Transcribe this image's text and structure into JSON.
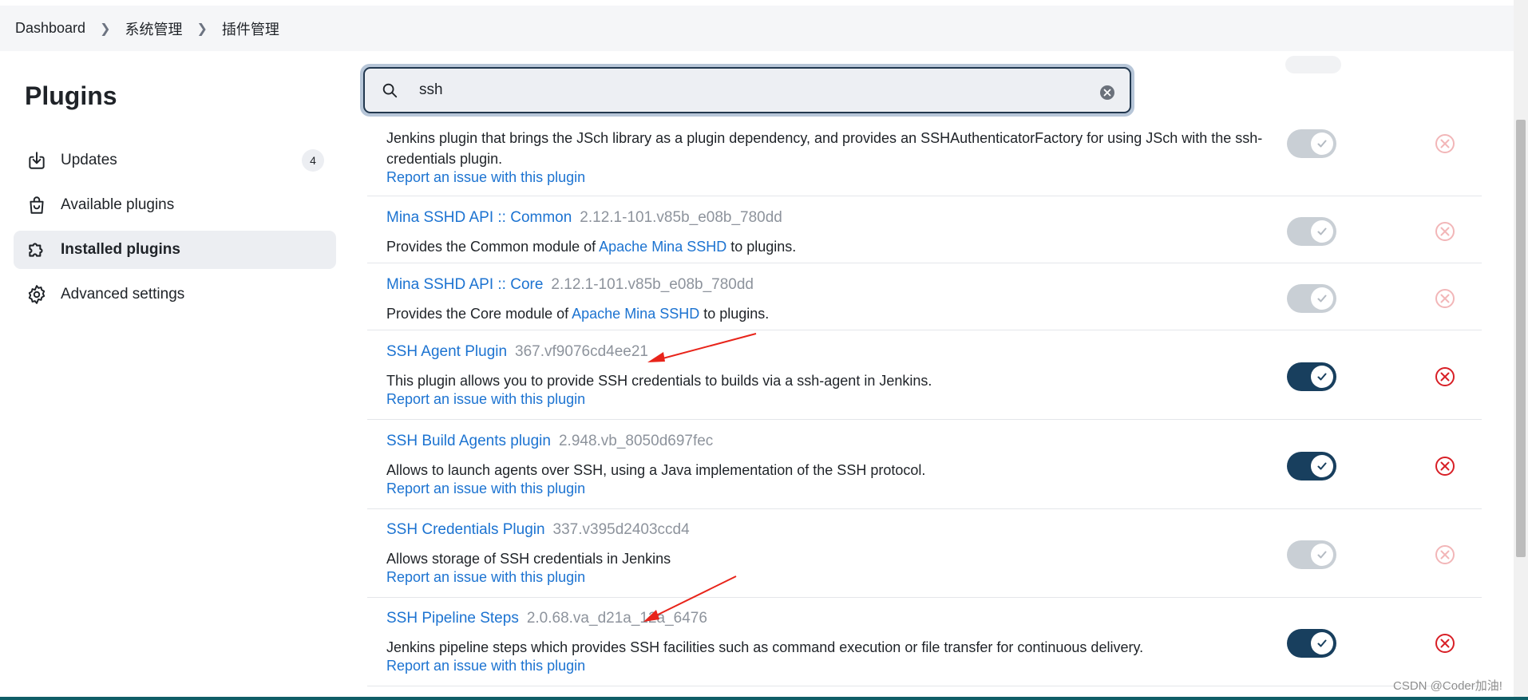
{
  "breadcrumb": [
    "Dashboard",
    "系统管理",
    "插件管理"
  ],
  "sidebar": {
    "title": "Plugins",
    "items": [
      {
        "label": "Updates",
        "badge": "4"
      },
      {
        "label": "Available plugins"
      },
      {
        "label": "Installed plugins"
      },
      {
        "label": "Advanced settings"
      }
    ]
  },
  "search": {
    "value": "ssh"
  },
  "plugins": [
    {
      "name": "",
      "version": "",
      "desc_parts": [
        "Jenkins plugin that brings the JSch library as a plugin dependency, and provides an SSHAuthenticatorFactory for using JSch with the ssh-credentials plugin."
      ],
      "report": "Report an issue with this plugin",
      "enabled": false
    },
    {
      "name": "Mina SSHD API :: Common",
      "version": "2.12.1-101.v85b_e08b_780dd",
      "desc_parts": [
        "Provides the Common module of ",
        "Apache Mina SSHD",
        " to plugins."
      ],
      "report": "",
      "enabled": false
    },
    {
      "name": "Mina SSHD API :: Core",
      "version": "2.12.1-101.v85b_e08b_780dd",
      "desc_parts": [
        "Provides the Core module of ",
        "Apache Mina SSHD",
        " to plugins."
      ],
      "report": "",
      "enabled": false
    },
    {
      "name": "SSH Agent Plugin",
      "version": "367.vf9076cd4ee21",
      "desc_parts": [
        "This plugin allows you to provide SSH credentials to builds via a ssh-agent in Jenkins."
      ],
      "report": "Report an issue with this plugin",
      "enabled": true
    },
    {
      "name": "SSH Build Agents plugin",
      "version": "2.948.vb_8050d697fec",
      "desc_parts": [
        "Allows to launch agents over SSH, using a Java implementation of the SSH protocol."
      ],
      "report": "Report an issue with this plugin",
      "enabled": true
    },
    {
      "name": "SSH Credentials Plugin",
      "version": "337.v395d2403ccd4",
      "desc_parts": [
        "Allows storage of SSH credentials in Jenkins"
      ],
      "report": "Report an issue with this plugin",
      "enabled": false
    },
    {
      "name": "SSH Pipeline Steps",
      "version": "2.0.68.va_d21a_12a_6476",
      "desc_parts": [
        "Jenkins pipeline steps which provides SSH facilities such as command execution or file transfer for continuous delivery."
      ],
      "report": "Report an issue with this plugin",
      "enabled": true
    }
  ],
  "watermark": "CSDN @Coder加油!",
  "colors": {
    "link": "#1c73d1",
    "toggle_on": "#183f5e",
    "toggle_off": "#c9cfd5",
    "uninstall_on": "#d81f26",
    "uninstall_off": "#f2b6b8",
    "arrow": "#e8241a"
  }
}
